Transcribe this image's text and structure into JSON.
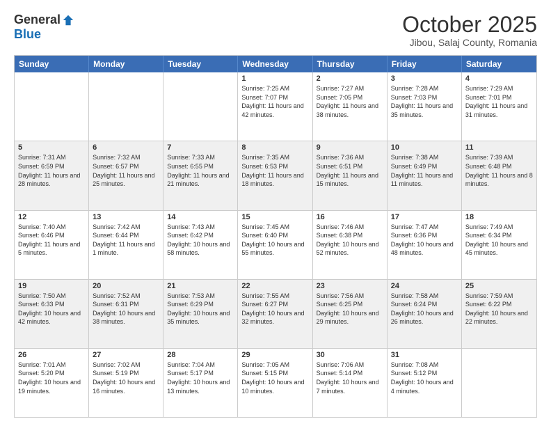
{
  "header": {
    "logo_general": "General",
    "logo_blue": "Blue",
    "title": "October 2025",
    "subtitle": "Jibou, Salaj County, Romania"
  },
  "calendar": {
    "days": [
      "Sunday",
      "Monday",
      "Tuesday",
      "Wednesday",
      "Thursday",
      "Friday",
      "Saturday"
    ],
    "rows": [
      [
        {
          "day": "",
          "text": ""
        },
        {
          "day": "",
          "text": ""
        },
        {
          "day": "",
          "text": ""
        },
        {
          "day": "1",
          "text": "Sunrise: 7:25 AM\nSunset: 7:07 PM\nDaylight: 11 hours and 42 minutes."
        },
        {
          "day": "2",
          "text": "Sunrise: 7:27 AM\nSunset: 7:05 PM\nDaylight: 11 hours and 38 minutes."
        },
        {
          "day": "3",
          "text": "Sunrise: 7:28 AM\nSunset: 7:03 PM\nDaylight: 11 hours and 35 minutes."
        },
        {
          "day": "4",
          "text": "Sunrise: 7:29 AM\nSunset: 7:01 PM\nDaylight: 11 hours and 31 minutes."
        }
      ],
      [
        {
          "day": "5",
          "text": "Sunrise: 7:31 AM\nSunset: 6:59 PM\nDaylight: 11 hours and 28 minutes."
        },
        {
          "day": "6",
          "text": "Sunrise: 7:32 AM\nSunset: 6:57 PM\nDaylight: 11 hours and 25 minutes."
        },
        {
          "day": "7",
          "text": "Sunrise: 7:33 AM\nSunset: 6:55 PM\nDaylight: 11 hours and 21 minutes."
        },
        {
          "day": "8",
          "text": "Sunrise: 7:35 AM\nSunset: 6:53 PM\nDaylight: 11 hours and 18 minutes."
        },
        {
          "day": "9",
          "text": "Sunrise: 7:36 AM\nSunset: 6:51 PM\nDaylight: 11 hours and 15 minutes."
        },
        {
          "day": "10",
          "text": "Sunrise: 7:38 AM\nSunset: 6:49 PM\nDaylight: 11 hours and 11 minutes."
        },
        {
          "day": "11",
          "text": "Sunrise: 7:39 AM\nSunset: 6:48 PM\nDaylight: 11 hours and 8 minutes."
        }
      ],
      [
        {
          "day": "12",
          "text": "Sunrise: 7:40 AM\nSunset: 6:46 PM\nDaylight: 11 hours and 5 minutes."
        },
        {
          "day": "13",
          "text": "Sunrise: 7:42 AM\nSunset: 6:44 PM\nDaylight: 11 hours and 1 minute."
        },
        {
          "day": "14",
          "text": "Sunrise: 7:43 AM\nSunset: 6:42 PM\nDaylight: 10 hours and 58 minutes."
        },
        {
          "day": "15",
          "text": "Sunrise: 7:45 AM\nSunset: 6:40 PM\nDaylight: 10 hours and 55 minutes."
        },
        {
          "day": "16",
          "text": "Sunrise: 7:46 AM\nSunset: 6:38 PM\nDaylight: 10 hours and 52 minutes."
        },
        {
          "day": "17",
          "text": "Sunrise: 7:47 AM\nSunset: 6:36 PM\nDaylight: 10 hours and 48 minutes."
        },
        {
          "day": "18",
          "text": "Sunrise: 7:49 AM\nSunset: 6:34 PM\nDaylight: 10 hours and 45 minutes."
        }
      ],
      [
        {
          "day": "19",
          "text": "Sunrise: 7:50 AM\nSunset: 6:33 PM\nDaylight: 10 hours and 42 minutes."
        },
        {
          "day": "20",
          "text": "Sunrise: 7:52 AM\nSunset: 6:31 PM\nDaylight: 10 hours and 38 minutes."
        },
        {
          "day": "21",
          "text": "Sunrise: 7:53 AM\nSunset: 6:29 PM\nDaylight: 10 hours and 35 minutes."
        },
        {
          "day": "22",
          "text": "Sunrise: 7:55 AM\nSunset: 6:27 PM\nDaylight: 10 hours and 32 minutes."
        },
        {
          "day": "23",
          "text": "Sunrise: 7:56 AM\nSunset: 6:25 PM\nDaylight: 10 hours and 29 minutes."
        },
        {
          "day": "24",
          "text": "Sunrise: 7:58 AM\nSunset: 6:24 PM\nDaylight: 10 hours and 26 minutes."
        },
        {
          "day": "25",
          "text": "Sunrise: 7:59 AM\nSunset: 6:22 PM\nDaylight: 10 hours and 22 minutes."
        }
      ],
      [
        {
          "day": "26",
          "text": "Sunrise: 7:01 AM\nSunset: 5:20 PM\nDaylight: 10 hours and 19 minutes."
        },
        {
          "day": "27",
          "text": "Sunrise: 7:02 AM\nSunset: 5:19 PM\nDaylight: 10 hours and 16 minutes."
        },
        {
          "day": "28",
          "text": "Sunrise: 7:04 AM\nSunset: 5:17 PM\nDaylight: 10 hours and 13 minutes."
        },
        {
          "day": "29",
          "text": "Sunrise: 7:05 AM\nSunset: 5:15 PM\nDaylight: 10 hours and 10 minutes."
        },
        {
          "day": "30",
          "text": "Sunrise: 7:06 AM\nSunset: 5:14 PM\nDaylight: 10 hours and 7 minutes."
        },
        {
          "day": "31",
          "text": "Sunrise: 7:08 AM\nSunset: 5:12 PM\nDaylight: 10 hours and 4 minutes."
        },
        {
          "day": "",
          "text": ""
        }
      ]
    ]
  }
}
